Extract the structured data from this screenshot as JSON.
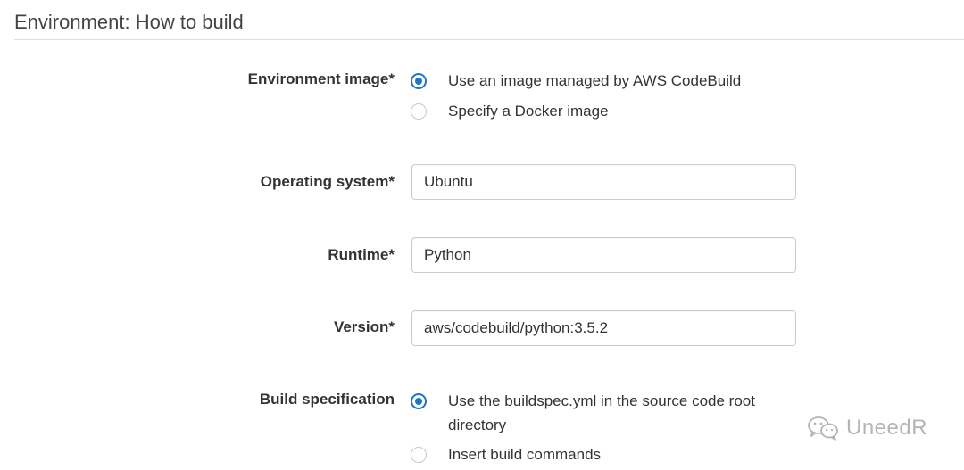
{
  "section": {
    "title": "Environment: How to build"
  },
  "environment_image": {
    "label": "Environment image*",
    "options": [
      {
        "label": "Use an image managed by AWS CodeBuild",
        "selected": true
      },
      {
        "label": "Specify a Docker image",
        "selected": false
      }
    ]
  },
  "operating_system": {
    "label": "Operating system*",
    "value": "Ubuntu"
  },
  "runtime": {
    "label": "Runtime*",
    "value": "Python"
  },
  "version": {
    "label": "Version*",
    "value": "aws/codebuild/python:3.5.2"
  },
  "build_specification": {
    "label": "Build specification",
    "options": [
      {
        "label": "Use the buildspec.yml in the source code root directory",
        "selected": true
      },
      {
        "label": "Insert build commands",
        "selected": false
      }
    ]
  },
  "watermark": {
    "text": "UneedR",
    "icon": "wechat-icon"
  },
  "colors": {
    "accent": "#1f74c5",
    "border": "#cccccc",
    "divider": "#dddddd",
    "watermark": "#b4b4b4"
  }
}
